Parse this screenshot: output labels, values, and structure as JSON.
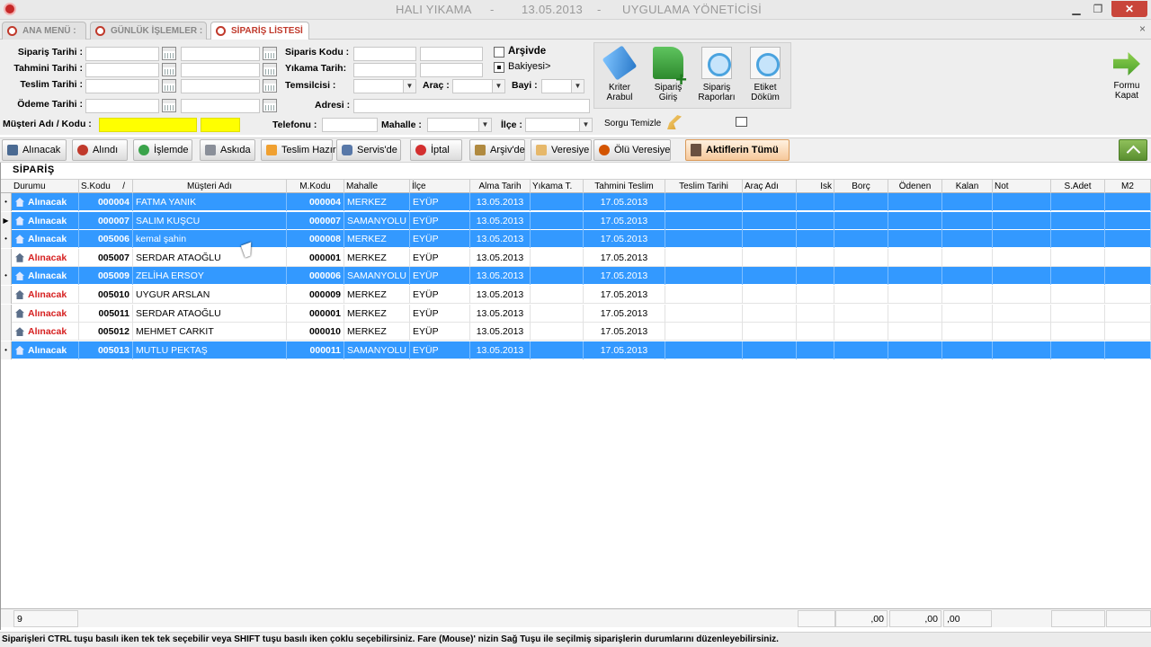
{
  "window": {
    "title_app": "HALI YIKAMA",
    "title_sep1": "-",
    "title_date": "13.05.2013",
    "title_sep2": "-",
    "title_user": "UYGULAMA YÖNETİCİSİ",
    "minimize": "▁",
    "maximize": "❐",
    "close": "✕"
  },
  "tabs": [
    {
      "label": "ANA MENÜ :",
      "active": false
    },
    {
      "label": "GÜNLÜK İŞLEMLER :",
      "active": false
    },
    {
      "label": "SİPARİŞ LİSTESİ",
      "active": true
    }
  ],
  "tab_close": "×",
  "filters": {
    "siparis_tarihi": "Sipariş Tarihi :",
    "tahmini_tarihi": "Tahmini Tarihi :",
    "teslim_tarihi": "Teslim Tarihi :",
    "odeme_tarihi": "Ödeme Tarihi :",
    "siparis_kodu": "Siparis Kodu :",
    "yikama_tarih": "Yıkama Tarih:",
    "temsilcisi": "Temsilcisi :",
    "arac": "Araç :",
    "bayi": "Bayi :",
    "adresi": "Adresi :",
    "arsivde": "Arşivde",
    "bakiyesi": "Bakiyesi>",
    "musteri": "Müşteri Adı / Kodu :",
    "telefonu": "Telefonu :",
    "mahalle": "Mahalle :",
    "ilce": "İlçe :",
    "sorgu_temizle": "Sorgu Temizle"
  },
  "actions": {
    "kriter_1": "Kriter",
    "kriter_2": "Arabul",
    "siparis_1": "Sipariş",
    "siparis_2": "Giriş",
    "rapor_1": "Sipariş",
    "rapor_2": "Raporları",
    "etiket_1": "Etiket",
    "etiket_2": "Döküm",
    "kapat_1": "Formu",
    "kapat_2": "Kapat"
  },
  "status_buttons": [
    "Alınacak",
    "Alındı",
    "İşlemde",
    "Askıda",
    "Teslim Hazır",
    "Servis'de",
    "İptal",
    "Arşiv'de",
    "Veresiye",
    "Ölü Veresiye",
    "Aktiflerin Tümü"
  ],
  "grid": {
    "title": "SİPARİŞ",
    "columns": [
      "Durumu",
      "S.Kodu",
      "Müşteri Adı",
      "M.Kodu",
      "Mahalle",
      "İlçe",
      "Alma Tarih",
      "Yıkama T.",
      "Tahmini Teslim",
      "Teslim Tarihi",
      "Araç Adı",
      "Isk",
      "Borç",
      "Ödenen",
      "Kalan",
      "Not",
      "S.Adet",
      "M2"
    ],
    "sort_marker": "/",
    "rows": [
      {
        "selected": true,
        "ind": "•",
        "durum": "Alınacak",
        "skodu": "000004",
        "musteri": "FATMA YANIK",
        "mkodu": "000004",
        "mahalle": "MERKEZ",
        "ilce": "EYÜP",
        "alma": "13.05.2013",
        "tahmini": "17.05.2013"
      },
      {
        "selected": true,
        "ind": "▶",
        "durum": "Alınacak",
        "skodu": "000007",
        "musteri": "SALIM KUŞCU",
        "mkodu": "000007",
        "mahalle": "SAMANYOLU",
        "ilce": "EYÜP",
        "alma": "13.05.2013",
        "tahmini": "17.05.2013"
      },
      {
        "selected": true,
        "ind": "•",
        "durum": "Alınacak",
        "skodu": "005006",
        "musteri": "kemal şahin",
        "mkodu": "000008",
        "mahalle": "MERKEZ",
        "ilce": "EYÜP",
        "alma": "13.05.2013",
        "tahmini": "17.05.2013"
      },
      {
        "selected": false,
        "ind": "",
        "durum": "Alınacak",
        "skodu": "005007",
        "musteri": "SERDAR ATAOĞLU",
        "mkodu": "000001",
        "mahalle": "MERKEZ",
        "ilce": "EYÜP",
        "alma": "13.05.2013",
        "tahmini": "17.05.2013"
      },
      {
        "selected": true,
        "ind": "•",
        "durum": "Alınacak",
        "skodu": "005009",
        "musteri": "ZELİHA ERSOY",
        "mkodu": "000006",
        "mahalle": "SAMANYOLU",
        "ilce": "EYÜP",
        "alma": "13.05.2013",
        "tahmini": "17.05.2013"
      },
      {
        "selected": false,
        "ind": "",
        "durum": "Alınacak",
        "skodu": "005010",
        "musteri": "UYGUR ARSLAN",
        "mkodu": "000009",
        "mahalle": "MERKEZ",
        "ilce": "EYÜP",
        "alma": "13.05.2013",
        "tahmini": "17.05.2013"
      },
      {
        "selected": false,
        "ind": "",
        "durum": "Alınacak",
        "skodu": "005011",
        "musteri": "SERDAR ATAOĞLU",
        "mkodu": "000001",
        "mahalle": "MERKEZ",
        "ilce": "EYÜP",
        "alma": "13.05.2013",
        "tahmini": "17.05.2013"
      },
      {
        "selected": false,
        "ind": "",
        "durum": "Alınacak",
        "skodu": "005012",
        "musteri": "MEHMET CARKIT",
        "mkodu": "000010",
        "mahalle": "MERKEZ",
        "ilce": "EYÜP",
        "alma": "13.05.2013",
        "tahmini": "17.05.2013"
      },
      {
        "selected": true,
        "ind": "•",
        "durum": "Alınacak",
        "skodu": "005013",
        "musteri": "MUTLU PEKTAŞ",
        "mkodu": "000011",
        "mahalle": "SAMANYOLU",
        "ilce": "EYÜP",
        "alma": "13.05.2013",
        "tahmini": "17.05.2013"
      }
    ],
    "footer": {
      "count": "9",
      "borc": ",00",
      "odenen": ",00",
      "kalan": ",00"
    }
  },
  "hint": "Siparişleri CTRL tuşu basılı iken tek tek seçebilir veya SHIFT tuşu basılı iken çoklu seçebilirsiniz. Fare (Mouse)' nizin Sağ Tuşu ile seçilmiş siparişlerin durumlarını düzenleyebilirsiniz.",
  "colors": {
    "selection": "#3399ff",
    "status_red": "#d62020",
    "active_tab": "#c0392b"
  }
}
